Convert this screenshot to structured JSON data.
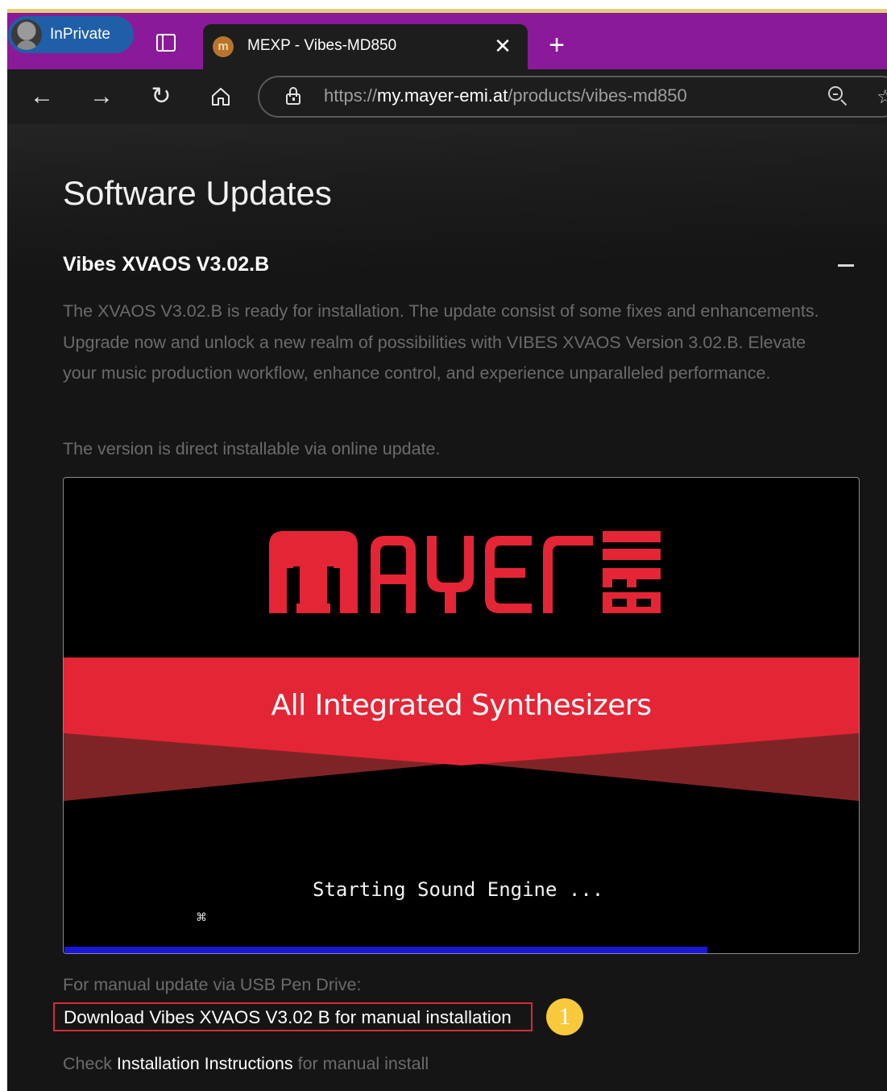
{
  "browser": {
    "inprivate_label": "InPrivate",
    "tab_title": "MEXP - Vibes-MD850",
    "tab_favicon_letter": "m",
    "url_scheme": "https://",
    "url_domain": "my.mayer-emi.at",
    "url_path": "/products/vibes-md850",
    "icons": [
      "profile-avatar-icon",
      "tab-actions-icon",
      "close-icon",
      "new-tab-icon",
      "back-arrow-icon",
      "forward-arrow-icon",
      "refresh-icon",
      "home-icon",
      "lock-icon",
      "zoom-icon",
      "favorite-star-icon"
    ]
  },
  "page": {
    "title": "Software Updates",
    "section_title": "Vibes XVAOS V3.02.B",
    "description": "The XVAOS V3.02.B is ready for installation. The update consist of some fixes and enhancements. Upgrade now and unlock a new realm of possibilities with VIBES XVAOS Version 3.02.B. Elevate your music production workflow, enhance control, and experience unparalleled performance.",
    "online_note": "The version is direct installable via online update.",
    "screenshot": {
      "logo_text": "mayer emi",
      "banner_text": "All Integrated Synthesizers",
      "boot_text": "Starting Sound Engine ...",
      "progress_fraction": 0.81,
      "progress_color": "#1a16d8",
      "brand_red": "#e42535"
    },
    "manual_label": "For manual update via USB Pen Drive:",
    "download_link": "Download Vibes XVAOS V3.02 B for manual installation",
    "badge_number": "1",
    "check_prefix": "Check ",
    "check_link": "Installation Instructions",
    "check_suffix": " for manual install"
  },
  "colors": {
    "tabbar": "#8b1a9a",
    "inprivate_pill": "#1f5fa8",
    "page_bg": "#151515",
    "highlight_border": "#d62b3a",
    "badge": "#f9c93c"
  }
}
